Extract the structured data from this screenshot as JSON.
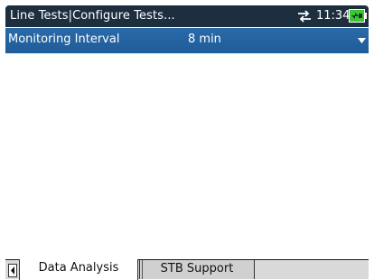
{
  "header": {
    "title": "Line Tests|Configure Tests...",
    "time": "11:34"
  },
  "param": {
    "label": "Monitoring Interval",
    "value": "8 min"
  },
  "tabs": [
    {
      "label": "Data Analysis",
      "active": true
    },
    {
      "label": "STB Support",
      "active": false
    }
  ],
  "colors": {
    "title_bar": "#1d2f3f",
    "selected_row": "#1f5c99",
    "battery": "#39c92b"
  },
  "icons": {
    "network": "network-transfer-icon",
    "battery": "battery-charging-icon",
    "dropdown": "chevron-down-icon",
    "tab_scroll": "tab-scroll-left-icon"
  }
}
